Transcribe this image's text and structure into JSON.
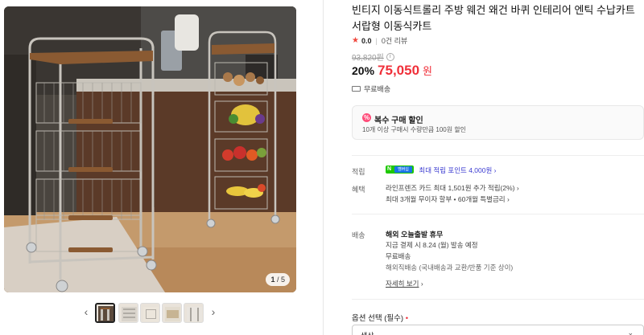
{
  "gallery": {
    "counter_current": "1",
    "counter_total": "/ 5",
    "prev_arrow": "‹",
    "next_arrow": "›",
    "thumbnail_count": 5
  },
  "product": {
    "title": "빈티지 이동식트롤리 주방 웨건 왜건 바퀴 인테리어 엔틱 수납카트 서랍형 이동식카트",
    "rating_score": "0.0",
    "review_count": "0건 리뷰",
    "original_price": "93,820원",
    "discount_rate": "20%",
    "sale_price": "75,050",
    "price_unit": "원",
    "free_shipping": "무료배송"
  },
  "promo": {
    "badge": "%",
    "title": "복수 구매 할인",
    "description": "10개 이상 구매시 수량만큼 100원 할인"
  },
  "benefits": {
    "points_label": "적립",
    "npay_n": "N",
    "npay_plus": "멤버십",
    "points_text": "최대 적립 포인트 4,000원 ›",
    "benefit_label": "혜택",
    "benefit_line1": "라인프렌즈 카드 최대 1,501원 추가 적립(2%) ›",
    "benefit_line2": "최대 3개월 무이자 할부 • 60개월 특별금리 ›"
  },
  "delivery": {
    "label": "배송",
    "line1": "해외 오늘출발 휴무",
    "line2": "지금 결제 시 8.24 (월) 발송 예정",
    "line3": "무료배송",
    "line4": "해외직배송 (국내배송과 교환/반품 기준 상이)",
    "details_link": "자세히 보기",
    "details_chevron": "›"
  },
  "options": {
    "label": "옵션 선택 (필수)",
    "required_mark": "•",
    "select_value": "색상",
    "select_chevron": "⌄"
  },
  "colors": {
    "accent_red": "#f0303a",
    "npay_green": "#1ec800",
    "promo_pink": "#ff4d7a"
  }
}
